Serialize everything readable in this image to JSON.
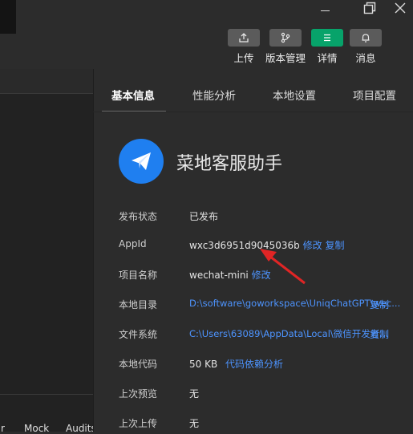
{
  "toolbar": {
    "buttons": [
      {
        "label": "上传",
        "icon": "upload-icon"
      },
      {
        "label": "版本管理",
        "icon": "branch-icon"
      },
      {
        "label": "详情",
        "icon": "menu-icon"
      },
      {
        "label": "消息",
        "icon": "bell-icon"
      }
    ],
    "active_color": "#07a36a"
  },
  "tabs": [
    "基本信息",
    "性能分析",
    "本地设置",
    "项目配置"
  ],
  "app": {
    "name": "菜地客服助手",
    "logo_color": "#1f7ff0"
  },
  "info": {
    "publish_status_label": "发布状态",
    "publish_status_value": "已发布",
    "appid_label": "AppId",
    "appid_value": "wxc3d6951d9045036b",
    "appid_edit": "修改",
    "appid_copy": "复制",
    "project_name_label": "项目名称",
    "project_name_value": "wechat-mini",
    "project_name_edit": "修改",
    "local_dir_label": "本地目录",
    "local_dir_value": "D:\\software\\goworkspace\\UniqChatGPT\\wec...",
    "local_dir_copy": "复制",
    "file_system_label": "文件系统",
    "file_system_value": "C:\\Users\\63089\\AppData\\Local\\微信开发者...",
    "file_system_copy": "复制",
    "local_code_label": "本地代码",
    "local_code_value": "50 KB",
    "local_code_link": "代码依赖分析",
    "last_preview_label": "上次预览",
    "last_preview_value": "无",
    "last_upload_label": "上次上传",
    "last_upload_value": "无"
  },
  "bottom_tabs": [
    "r",
    "Mock",
    "Audits"
  ],
  "link_color": "#4d94ff"
}
